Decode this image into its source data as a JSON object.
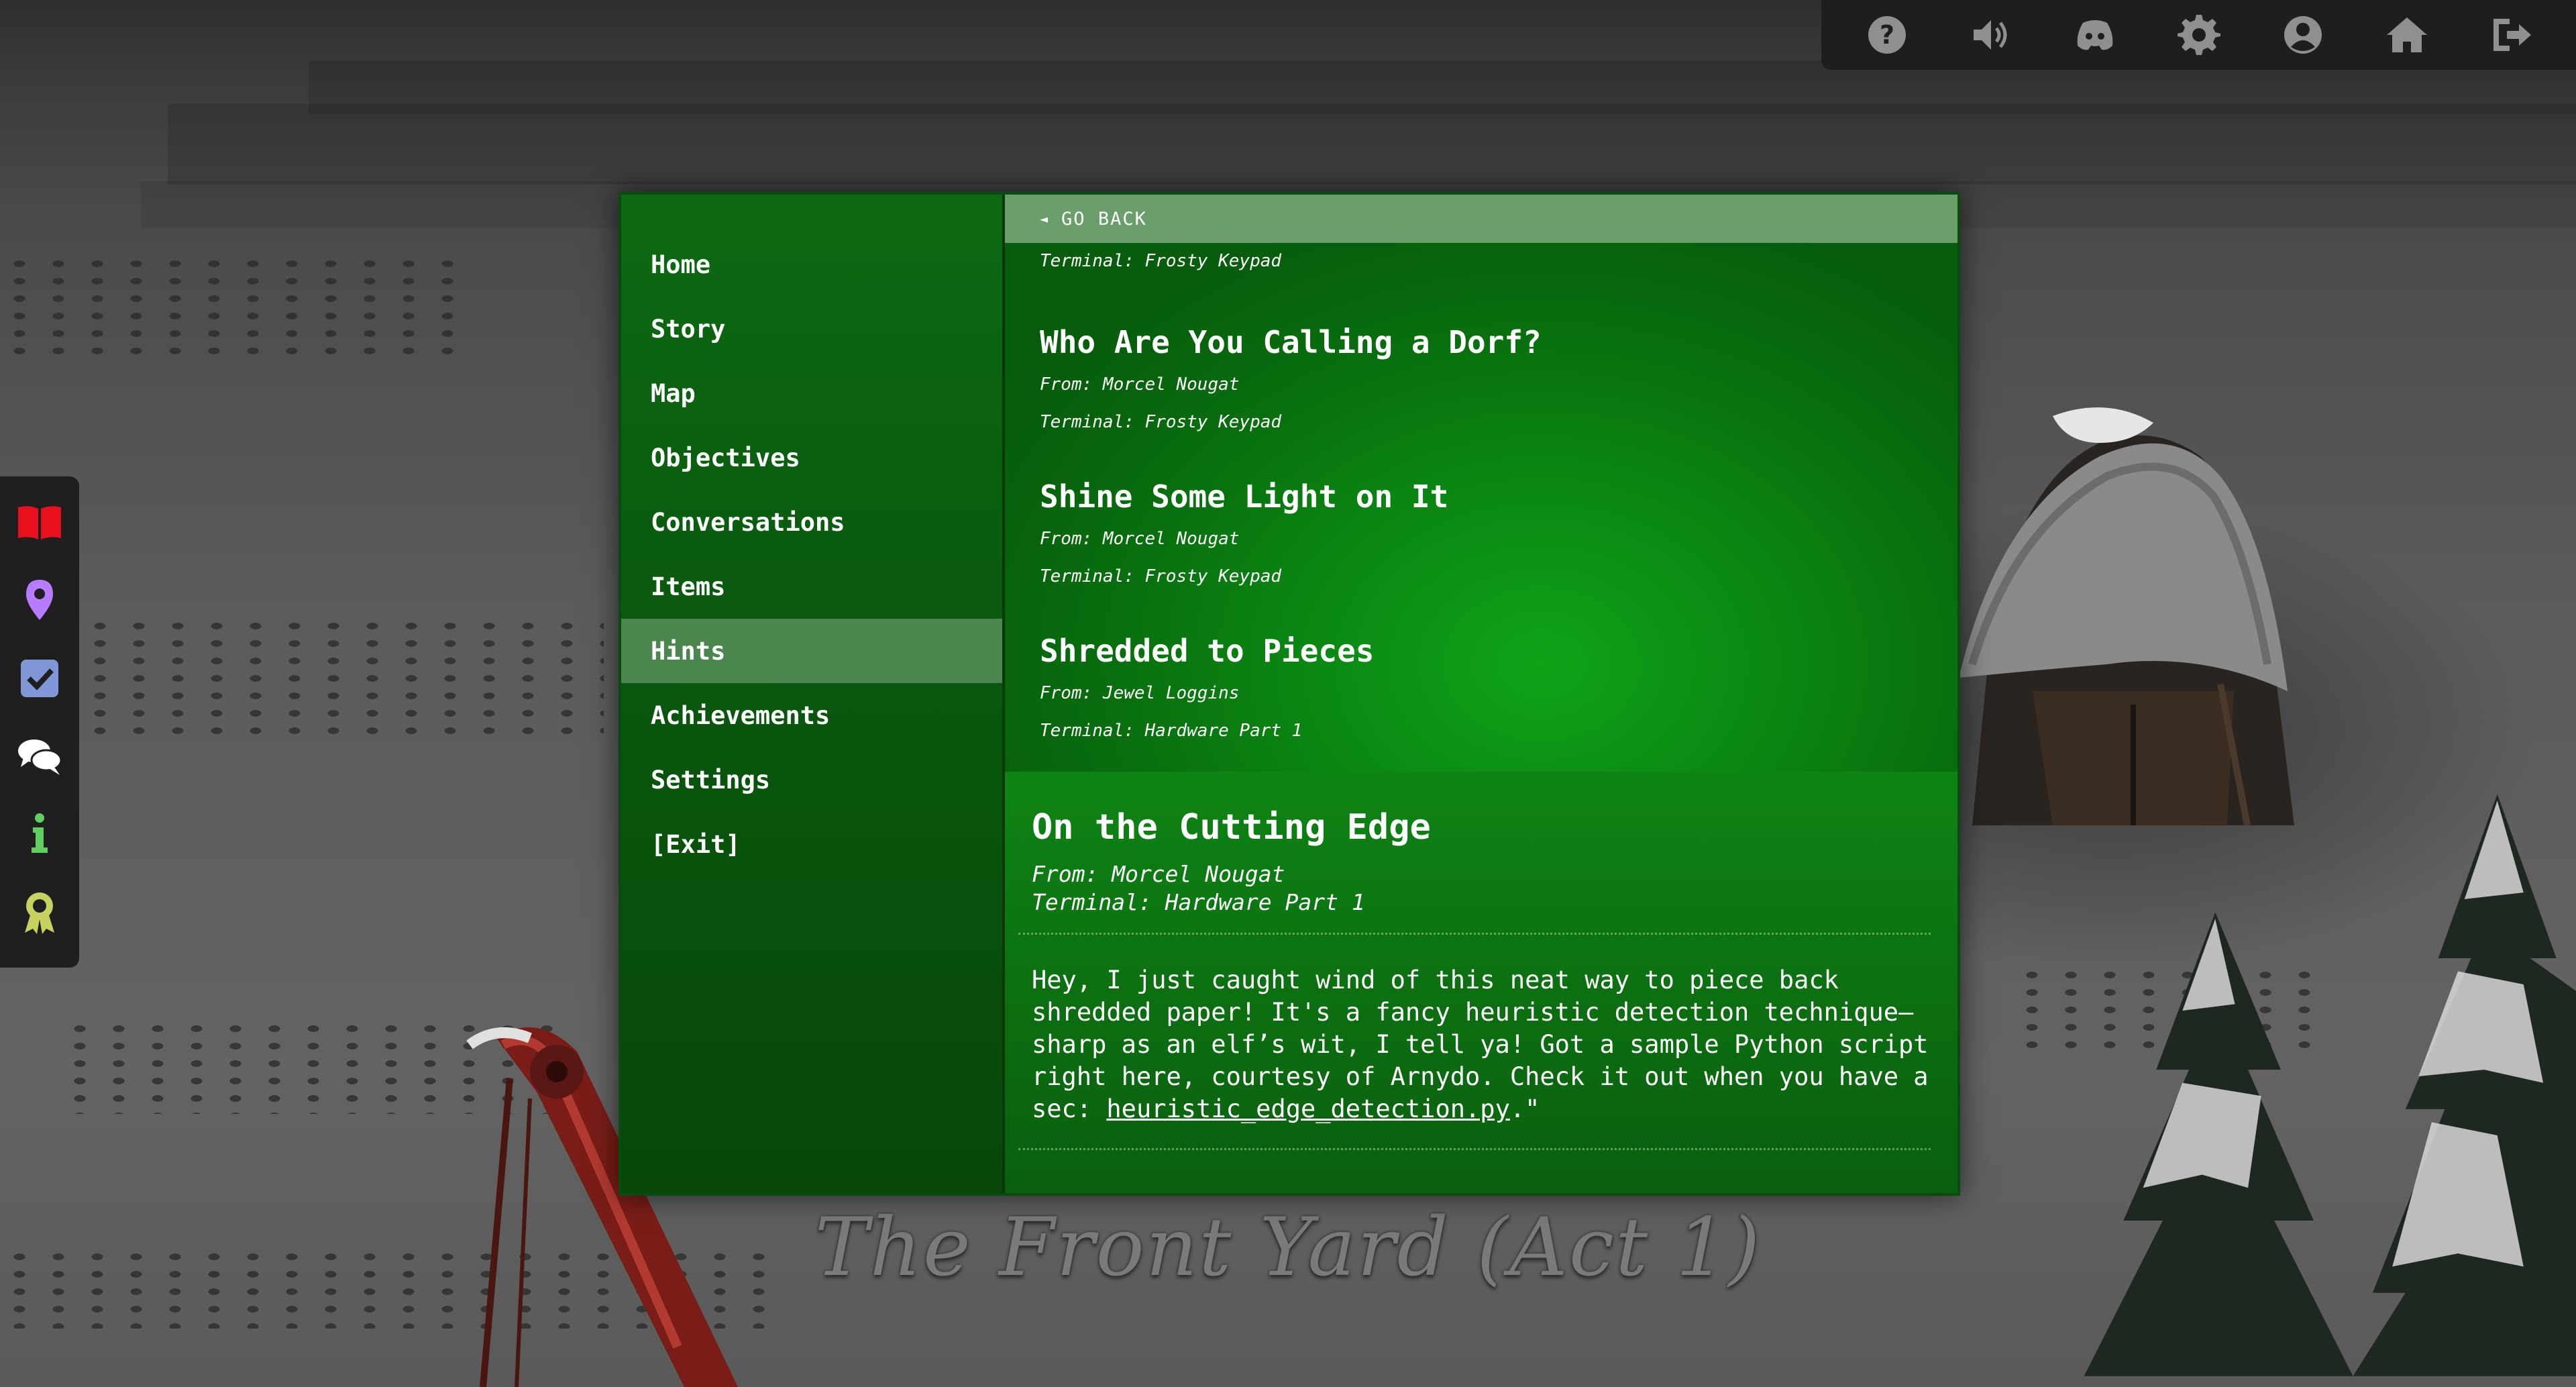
{
  "scene": {
    "location_title": "The Front Yard (Act 1)"
  },
  "top_bar": {
    "icons": [
      "help-icon",
      "sound-icon",
      "discord-icon",
      "settings-icon",
      "profile-icon",
      "home-icon",
      "logout-icon"
    ]
  },
  "side_bar": {
    "icons": [
      "book-icon",
      "map-pin-icon",
      "objectives-checkbox-icon",
      "conversations-icon",
      "info-icon",
      "achievement-ribbon-icon"
    ],
    "colors": {
      "book": "#e8101c",
      "pin": "#b77bff",
      "check": "#7f97d6",
      "chat": "#ffffff",
      "info": "#5fcf5f",
      "ribbon": "#c8d260"
    }
  },
  "menu": {
    "items": [
      {
        "label": "Home"
      },
      {
        "label": "Story"
      },
      {
        "label": "Map"
      },
      {
        "label": "Objectives"
      },
      {
        "label": "Conversations"
      },
      {
        "label": "Items"
      },
      {
        "label": "Hints"
      },
      {
        "label": "Achievements"
      },
      {
        "label": "Settings"
      },
      {
        "label": "[Exit]"
      }
    ],
    "active": "Hints"
  },
  "content": {
    "go_back_label": "GO BACK",
    "hints": [
      {
        "title": "",
        "from": "",
        "terminal": "Terminal: Frosty Keypad"
      },
      {
        "title": "Who Are You Calling a Dorf?",
        "from": "From: Morcel Nougat",
        "terminal": "Terminal: Frosty Keypad"
      },
      {
        "title": "Shine Some Light on It",
        "from": "From: Morcel Nougat",
        "terminal": "Terminal: Frosty Keypad"
      },
      {
        "title": "Shredded to Pieces",
        "from": "From: Jewel Loggins",
        "terminal": "Terminal: Hardware Part 1"
      }
    ],
    "detail": {
      "title": "On the Cutting Edge",
      "from": "From: Morcel Nougat",
      "terminal": "Terminal: Hardware Part 1",
      "body_text": "Hey, I just caught wind of this neat way to piece back shredded paper! It's a fancy heuristic detection technique—sharp as an elf’s wit, I tell ya! Got a sample Python script right here, courtesy of Arnydo. Check it out when you have a sec: ",
      "body_link": "heuristic_edge_detection.py",
      "body_tail": ".\""
    }
  }
}
